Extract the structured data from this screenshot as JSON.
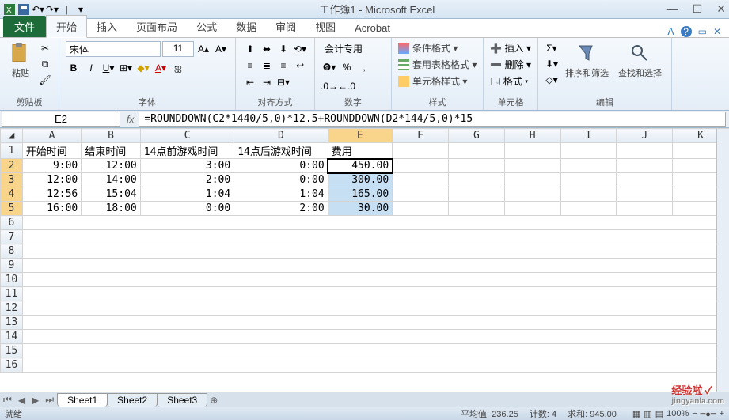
{
  "title": "工作簿1 - Microsoft Excel",
  "tabs": {
    "file": "文件",
    "list": [
      "开始",
      "插入",
      "页面布局",
      "公式",
      "数据",
      "审阅",
      "视图",
      "Acrobat"
    ],
    "active": 0
  },
  "ribbon": {
    "clipboard": {
      "label": "剪贴板",
      "paste": "粘贴"
    },
    "font": {
      "label": "字体",
      "name": "宋体",
      "size": "11"
    },
    "align": {
      "label": "对齐方式"
    },
    "number": {
      "label": "数字",
      "format": "会计专用"
    },
    "styles": {
      "label": "样式",
      "cond": "条件格式 ▾",
      "table": "套用表格格式 ▾",
      "cell": "单元格样式 ▾"
    },
    "cells": {
      "label": "单元格",
      "insert": "插入 ▾",
      "delete": "删除 ▾",
      "format": "格式 ▾"
    },
    "editing": {
      "label": "编辑",
      "sort": "排序和筛选",
      "find": "查找和选择"
    }
  },
  "namebox": "E2",
  "formula": "=ROUNDDOWN(C2*1440/5,0)*12.5+ROUNDDOWN(D2*144/5,0)*15",
  "columns": [
    "A",
    "B",
    "C",
    "D",
    "E",
    "F",
    "G",
    "H",
    "I",
    "J",
    "K"
  ],
  "headers": [
    "开始时间",
    "结束时间",
    "14点前游戏时间",
    "14点后游戏时间",
    "费用"
  ],
  "rows": [
    {
      "a": "9:00",
      "b": "12:00",
      "c": "3:00",
      "d": "0:00",
      "e": "450.00"
    },
    {
      "a": "12:00",
      "b": "14:00",
      "c": "2:00",
      "d": "0:00",
      "e": "300.00"
    },
    {
      "a": "12:56",
      "b": "15:04",
      "c": "1:04",
      "d": "1:04",
      "e": "165.00"
    },
    {
      "a": "16:00",
      "b": "18:00",
      "c": "0:00",
      "d": "2:00",
      "e": "30.00"
    }
  ],
  "sheets": [
    "Sheet1",
    "Sheet2",
    "Sheet3"
  ],
  "status": {
    "mode": "就绪",
    "avg_lbl": "平均值:",
    "avg": "236.25",
    "cnt_lbl": "计数:",
    "cnt": "4",
    "sum_lbl": "求和:",
    "sum": "945.00",
    "zoom": "100%"
  },
  "watermark": {
    "main": "经验啦 ✓",
    "sub": "jingyanla.com"
  }
}
